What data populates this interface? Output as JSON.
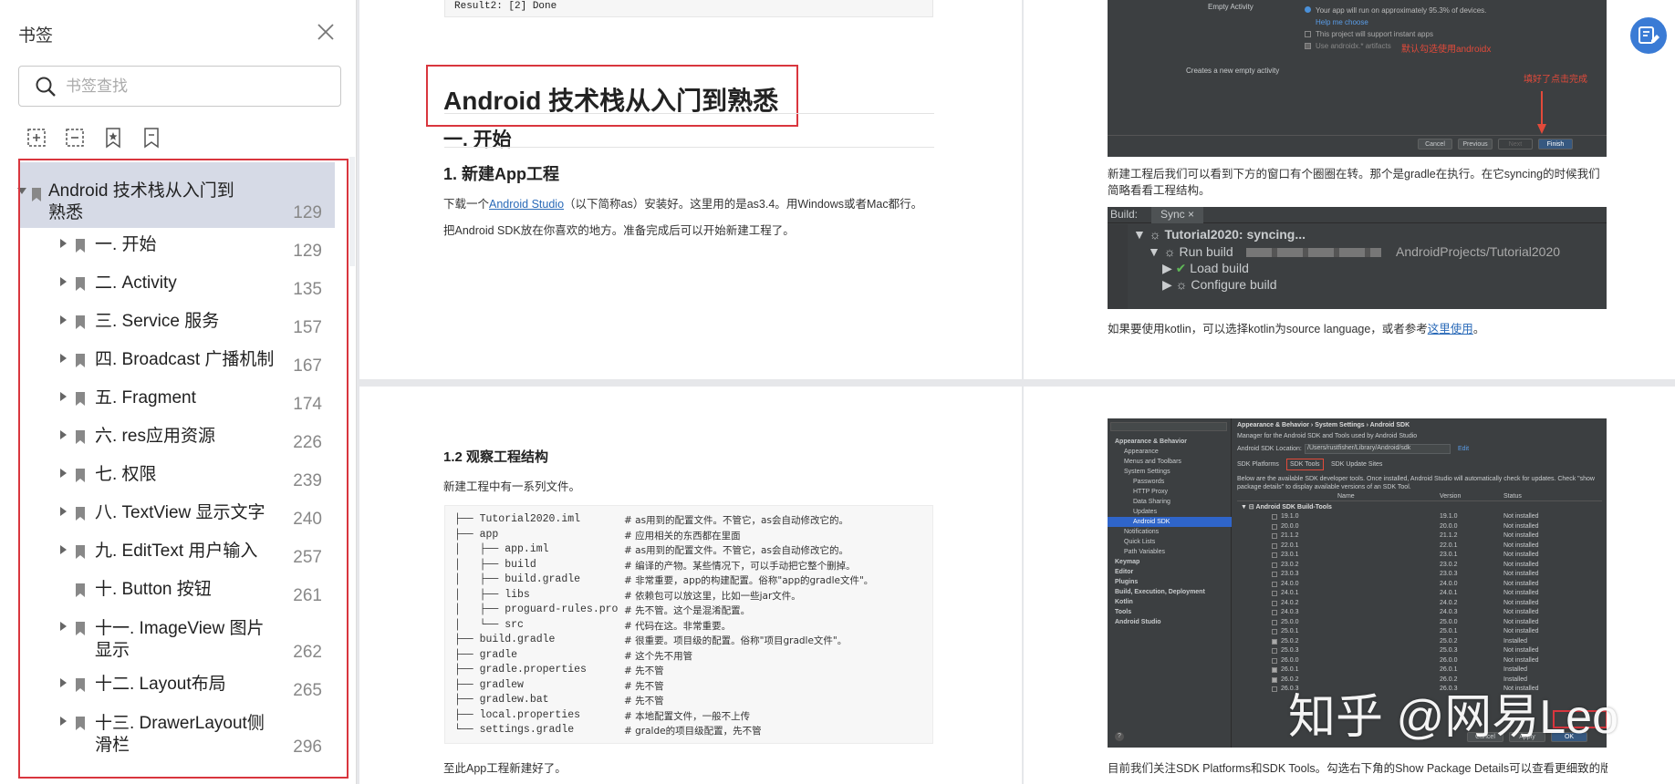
{
  "sidebar": {
    "title": "书签",
    "search_placeholder": "书签查找",
    "toolbar_icons": [
      "add-bookmark-icon",
      "remove-bookmark-icon",
      "bookmark-star-icon",
      "bookmark-icon"
    ],
    "items": [
      {
        "label_l1": "Android 技术栈从入门到",
        "label_l2": "熟悉",
        "page": "129",
        "level": 0,
        "expanded": true,
        "selected": true
      },
      {
        "label": "一. 开始",
        "page": "129",
        "level": 1,
        "has_children": true
      },
      {
        "label": "二. Activity",
        "page": "135",
        "level": 1,
        "has_children": true
      },
      {
        "label": "三. Service 服务",
        "page": "157",
        "level": 1,
        "has_children": true
      },
      {
        "label": "四. Broadcast 广播机制",
        "page": "167",
        "level": 1,
        "has_children": true
      },
      {
        "label": "五. Fragment",
        "page": "174",
        "level": 1,
        "has_children": true
      },
      {
        "label": "六. res应用资源",
        "page": "226",
        "level": 1,
        "has_children": true
      },
      {
        "label": "七. 权限",
        "page": "239",
        "level": 1,
        "has_children": true
      },
      {
        "label": "八. TextView 显示文字",
        "page": "240",
        "level": 1,
        "has_children": true
      },
      {
        "label": "九. EditText 用户输入",
        "page": "257",
        "level": 1,
        "has_children": true
      },
      {
        "label": "十. Button 按钮",
        "page": "261",
        "level": 1,
        "has_children": false
      },
      {
        "label_l1": "十一. ImageView 图片",
        "label_l2": "显示",
        "page": "262",
        "level": 1,
        "has_children": true
      },
      {
        "label": "十二. Layout布局",
        "page": "265",
        "level": 1,
        "has_children": true
      },
      {
        "label_l1": "十三. DrawerLayout侧",
        "label_l2": "滑栏",
        "page": "296",
        "level": 1,
        "has_children": true
      }
    ]
  },
  "doc": {
    "result_line": "Result2: [2] Done",
    "h1": "Android 技术栈从入门到熟悉",
    "h2": "一. 开始",
    "h3": "1. 新建App工程",
    "p1_pre": "下载一个",
    "p1_link": "Android Studio",
    "p1_post": "（以下简称as）安装好。这里用的是as3.4。用Windows或者Mac都行。",
    "p2": "把Android SDK放在你喜欢的地方。准备完成后可以开始新建工程了。",
    "wizard": {
      "empty_activity": "Empty Activity",
      "devices_text": "Your app will run on approximately 95.3% of devices.",
      "help": "Help me choose",
      "instant": "This project will support instant apps",
      "androidx": "Use androidx.* artifacts",
      "androidx_note": "默认勾选使用androidx",
      "create_note": "Creates a new empty activity",
      "finish_note": "填好了点击完成",
      "buttons": [
        "Cancel",
        "Previous",
        "Next",
        "Finish"
      ]
    },
    "p3": "新建工程后我们可以看到下方的窗口有个圈圈在转。那个是gradle在执行。在它syncing的时候我们简略看看工程结构。",
    "build": {
      "tab_build": "Build:",
      "tab_sync": "Sync",
      "lines": [
        "Tutorial2020: syncing...",
        "Run build",
        "AndroidProjects/Tutorial2020",
        "Load build",
        "Configure build"
      ]
    },
    "p4_pre": "如果要使用kotlin，可以选择kotlin为source language，或者参考",
    "p4_link": "这里使用",
    "p4_post": "。",
    "h4": "1.2 观察工程结构",
    "p5": "新建工程中有一系列文件。",
    "tree": [
      [
        "├── Tutorial2020.iml",
        "# as用到的配置文件。不管它，as会自动修改它的。"
      ],
      [
        "├── app",
        "# 应用相关的东西都在里面"
      ],
      [
        "│   ├── app.iml",
        "# as用到的配置文件。不管它，as会自动修改它的。"
      ],
      [
        "│   ├── build",
        "# 编译的产物。某些情况下，可以手动把它整个删掉。"
      ],
      [
        "│   ├── build.gradle",
        "# 非常重要，app的构建配置。俗称\"app的gradle文件\"。"
      ],
      [
        "│   ├── libs",
        "# 依赖包可以放这里，比如一些jar文件。"
      ],
      [
        "│   ├── proguard-rules.pro",
        "# 先不管。这个是混淆配置。"
      ],
      [
        "│   └── src",
        "# 代码在这。非常重要。"
      ],
      [
        "├── build.gradle",
        "# 很重要。项目级的配置。俗称\"项目gradle文件\"。"
      ],
      [
        "├── gradle",
        "# 这个先不用管"
      ],
      [
        "├── gradle.properties",
        "# 先不管"
      ],
      [
        "├── gradlew",
        "# 先不管"
      ],
      [
        "├── gradlew.bat",
        "# 先不管"
      ],
      [
        "├── local.properties",
        "# 本地配置文件，一般不上传"
      ],
      [
        "└── settings.gradle",
        "# gralde的项目级配置，先不管"
      ]
    ],
    "p6": "至此App工程新建好了。",
    "sdk": {
      "breadcrumb": "Appearance & Behavior  ›  System Settings  ›  Android SDK",
      "desc": "Manager for the Android SDK and Tools used by Android Studio",
      "location_label": "Android SDK Location:",
      "location_value": "/Users/rustfisher/Library/Android/sdk",
      "edit": "Edit",
      "tabs": [
        "SDK Platforms",
        "SDK Tools",
        "SDK Update Sites"
      ],
      "info": "Below are the available SDK developer tools. Once installed, Android Studio will automatically check for updates. Check \"show package details\" to display available versions of an SDK Tool.",
      "cols": [
        "Name",
        "Version",
        "Status"
      ],
      "tree": [
        "Appearance & Behavior",
        "Appearance",
        "Menus and Toolbars",
        "System Settings",
        "Passwords",
        "HTTP Proxy",
        "Data Sharing",
        "Updates",
        "Android SDK",
        "Notifications",
        "Quick Lists",
        "Path Variables",
        "Keymap",
        "Editor",
        "Plugins",
        "Build, Execution, Deployment",
        "Kotlin",
        "Tools",
        "Android Studio"
      ],
      "group": "Android SDK Build-Tools",
      "rows": [
        [
          "19.1.0",
          "19.1.0",
          "Not installed"
        ],
        [
          "20.0.0",
          "20.0.0",
          "Not installed"
        ],
        [
          "21.1.2",
          "21.1.2",
          "Not installed"
        ],
        [
          "22.0.1",
          "22.0.1",
          "Not installed"
        ],
        [
          "23.0.1",
          "23.0.1",
          "Not installed"
        ],
        [
          "23.0.2",
          "23.0.2",
          "Not installed"
        ],
        [
          "23.0.3",
          "23.0.3",
          "Not installed"
        ],
        [
          "24.0.0",
          "24.0.0",
          "Not installed"
        ],
        [
          "24.0.1",
          "24.0.1",
          "Not installed"
        ],
        [
          "24.0.2",
          "24.0.2",
          "Not installed"
        ],
        [
          "24.0.3",
          "24.0.3",
          "Not installed"
        ],
        [
          "25.0.0",
          "25.0.0",
          "Not installed"
        ],
        [
          "25.0.1",
          "25.0.1",
          "Not installed"
        ],
        [
          "25.0.2",
          "25.0.2",
          "Installed"
        ],
        [
          "25.0.3",
          "25.0.3",
          "Not installed"
        ],
        [
          "26.0.0",
          "26.0.0",
          "Not installed"
        ],
        [
          "26.0.1",
          "26.0.1",
          "Installed"
        ],
        [
          "26.0.2",
          "26.0.2",
          "Installed"
        ],
        [
          "26.0.3",
          "26.0.3",
          "Not installed"
        ]
      ],
      "buttons": [
        "Cancel",
        "Apply",
        "OK"
      ]
    },
    "p7": "目前我们关注SDK Platforms和SDK Tools。勾选右下角的Show Package Details可以查看更细致的版本",
    "watermark": "知乎 @网易Leo"
  }
}
